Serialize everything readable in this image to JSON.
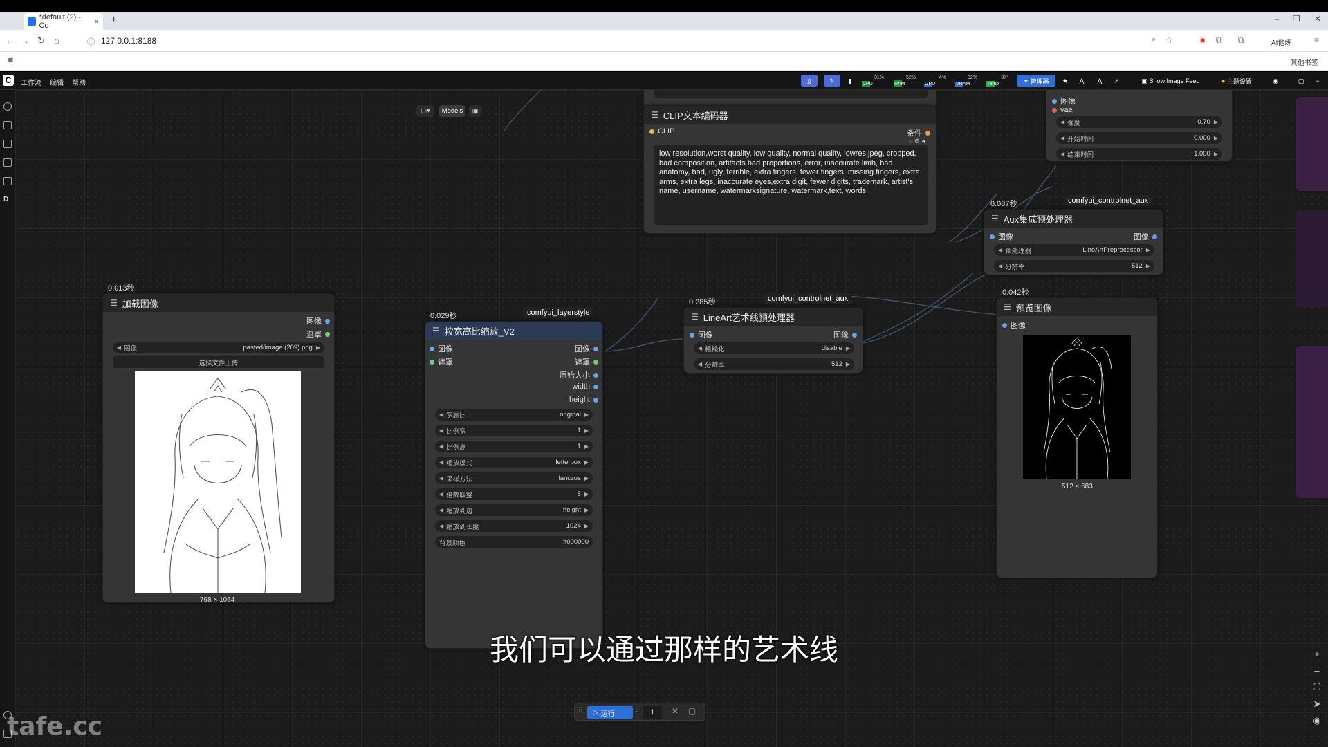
{
  "browser": {
    "tab_title": "*default (2) - Co",
    "url": "127.0.0.1:8188",
    "bookmarks_label": "其他书签",
    "ai_label": "AI他练"
  },
  "menu": {
    "items": [
      "工作流",
      "编辑",
      "帮助"
    ]
  },
  "toolbar": {
    "manager_label": "管理器",
    "image_feed_label": "Show Image Feed",
    "theme_label": "主题设置",
    "stats": [
      {
        "label": "CPU",
        "pct": "31%"
      },
      {
        "label": "RAM",
        "pct": "52%"
      },
      {
        "label": "GPU",
        "pct": "4%"
      },
      {
        "label": "VRAM",
        "pct": "32%"
      },
      {
        "label": "Temp",
        "pct": "37°"
      }
    ]
  },
  "canvas_toolbar": {
    "models_label": "Models"
  },
  "nodes": {
    "load_image": {
      "timing": "0.013秒",
      "title": "加载图像",
      "out_image": "图像",
      "out_mask": "遮罩",
      "image_label": "图像",
      "image_value": "pasted/image (209).png",
      "upload_label": "选择文件上传",
      "dims": "798 × 1064"
    },
    "resize": {
      "timing": "0.029秒",
      "badge": "comfyui_layerstyle",
      "title": "按宽高比缩放_V2",
      "in_image": "图像",
      "in_mask": "遮罩",
      "out_image": "图像",
      "out_mask": "遮罩",
      "out_orig_size": "原始大小",
      "out_width": "width",
      "out_height": "height",
      "widgets": [
        {
          "label": "宽高比",
          "value": "original"
        },
        {
          "label": "比例宽",
          "value": "1"
        },
        {
          "label": "比例高",
          "value": "1"
        },
        {
          "label": "缩放模式",
          "value": "letterbox"
        },
        {
          "label": "采样方法",
          "value": "lanczos"
        },
        {
          "label": "倍数取整",
          "value": "8"
        },
        {
          "label": "缩放到边",
          "value": "height"
        },
        {
          "label": "缩放到长度",
          "value": "1024"
        }
      ],
      "bg_color_label": "背景颜色",
      "bg_color_value": "#000000"
    },
    "clip": {
      "title": "CLIP文本编码器",
      "in_clip": "CLIP",
      "out_cond": "条件",
      "text": "low resolution,worst quality, low quality, normal quality, lowres,jpeg, cropped, bad composition, artifacts bad proportions, error, inaccurate limb, bad anatomy, bad, ugly, terrible, extra fingers, fewer fingers, missing fingers, extra arms, extra legs, inaccurate eyes,extra digit, fewer digits, trademark, artist's name, username, watermarksignature, watermark,text, words,"
    },
    "lineart": {
      "timing": "0.285秒",
      "badge": "comfyui_controlnet_aux",
      "title": "LineArt艺术线预处理器",
      "in_image": "图像",
      "out_image": "图像",
      "widgets": [
        {
          "label": "粗糙化",
          "value": "disable"
        },
        {
          "label": "分辨率",
          "value": "512"
        }
      ]
    },
    "controlnet_apply": {
      "in_image": "图像",
      "in_vae": "vae",
      "widgets": [
        {
          "label": "强度",
          "value": "0.70"
        },
        {
          "label": "开始时间",
          "value": "0.000"
        },
        {
          "label": "结束时间",
          "value": "1.000"
        }
      ]
    },
    "aux": {
      "timing": "0.087秒",
      "badge": "comfyui_controlnet_aux",
      "title": "Aux集成预处理器",
      "in_image": "图像",
      "out_image": "图像",
      "widgets": [
        {
          "label": "预处理器",
          "value": "LineArtPreprocessor"
        },
        {
          "label": "分辨率",
          "value": "512"
        }
      ]
    },
    "preview": {
      "timing": "0.042秒",
      "title": "预览图像",
      "in_image": "图像",
      "dims": "512 × 683"
    }
  },
  "run": {
    "label": "运行",
    "count": "1"
  },
  "subtitle": "我们可以通过那样的艺术线",
  "watermark": "tafe.cc"
}
